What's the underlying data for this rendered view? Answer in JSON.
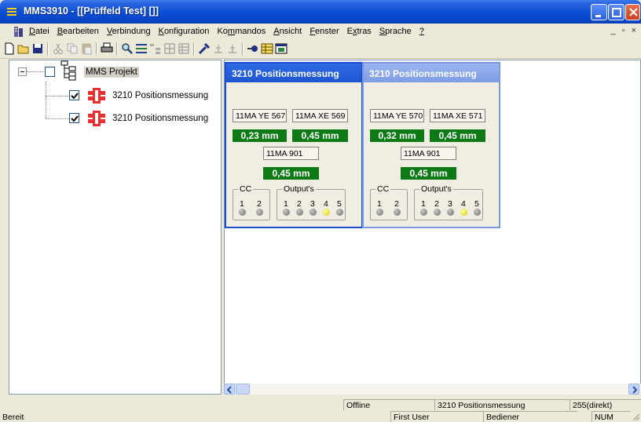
{
  "window": {
    "title": "MMS3910 - [[Prüffeld Test] []]"
  },
  "menu": {
    "items": [
      "Datei",
      "Bearbeiten",
      "Verbindung",
      "Konfiguration",
      "Kommandos",
      "Ansicht",
      "Fenster",
      "Extras",
      "Sprache",
      "?"
    ],
    "mdi_controls": [
      "_",
      "▫",
      "×"
    ]
  },
  "toolbar": {
    "icons": [
      "new-icon",
      "open-icon",
      "save-icon",
      "cut-icon",
      "copy-icon",
      "paste-icon",
      "print-icon",
      "search-icon",
      "list-icon",
      "tree-icon",
      "grid-icon",
      "grid2-icon",
      "tools-icon",
      "antenna-icon",
      "antenna2-icon",
      "connect-icon",
      "table-icon",
      "window-icon"
    ]
  },
  "tree": {
    "root_label": "MMS Projekt",
    "items": [
      {
        "label": "3210 Positionsmessung",
        "checked": true
      },
      {
        "label": "3210 Positionsmessung",
        "checked": true
      }
    ]
  },
  "modules": [
    {
      "title": "3210 Positionsmessung",
      "active": true,
      "fields": [
        "11MA YE 567",
        "11MA XE 569",
        "11MA 901"
      ],
      "values": [
        "0,23 mm",
        "0,45 mm",
        "0,45 mm"
      ],
      "cc_label": "CC",
      "cc_leds": [
        "1",
        "2"
      ],
      "output_label": "Output's",
      "output_leds": [
        "1",
        "2",
        "3",
        "4",
        "5"
      ],
      "output_on": 4
    },
    {
      "title": "3210 Positionsmessung",
      "active": false,
      "fields": [
        "11MA YE 570",
        "11MA XE 571",
        "11MA 901"
      ],
      "values": [
        "0,32 mm",
        "0,45 mm",
        "0,45 mm"
      ],
      "cc_label": "CC",
      "cc_leds": [
        "1",
        "2"
      ],
      "output_label": "Output's",
      "output_leds": [
        "1",
        "2",
        "3",
        "4",
        "5"
      ],
      "output_on": 4
    }
  ],
  "status": {
    "ready": "Bereit",
    "connection": "Offline",
    "module": "3210 Positionsmessung",
    "address": "255(direkt)",
    "user": "First User",
    "role": "Bediener",
    "num": "NUM"
  }
}
